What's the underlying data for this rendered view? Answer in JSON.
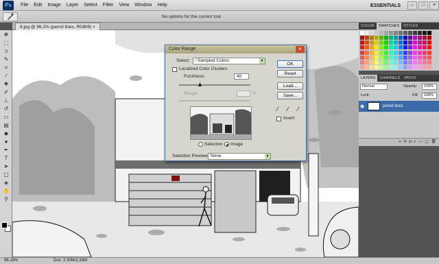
{
  "app": {
    "logo": "Ps",
    "menu": [
      "File",
      "Edit",
      "Image",
      "Layer",
      "Select",
      "Filter",
      "View",
      "Window",
      "Help"
    ],
    "workspace": "ESSENTIALS",
    "window_min": "–",
    "window_max": "□",
    "window_close": "×"
  },
  "options_bar": {
    "message": "No options for the current tool."
  },
  "document": {
    "tab_label": "8.jpg @ 96.2% (pencil lines, RGB/8)",
    "tab_close": "×"
  },
  "status_bar": {
    "zoom": "96.16%",
    "doc_size": "Doc: 2.30M/2.30M"
  },
  "panels": {
    "color_tabs": [
      "COLOR",
      "SWATCHES",
      "STYLES"
    ],
    "layer_tabs": [
      "LAYERS",
      "CHANNELS",
      "PATHS"
    ],
    "blend_mode": "Normal",
    "opacity_label": "Opacity:",
    "opacity_value": "100%",
    "lock_label": "Lock:",
    "fill_label": "Fill:",
    "fill_value": "100%",
    "layer_name": "pencil lines"
  },
  "dialog": {
    "title": "Color Range",
    "close": "×",
    "select_label": "Select:",
    "select_value": "Sampled Colors",
    "localized_label": "Localized Color Clusters",
    "fuzziness_label": "Fuzziness:",
    "fuzziness_value": "40",
    "range_label": "Range:",
    "range_unit": "%",
    "radio_selection": "Selection",
    "radio_image": "Image",
    "preview_label": "Selection Preview:",
    "preview_value": "None",
    "ok": "OK",
    "reset": "Reset",
    "load": "Load...",
    "save": "Save...",
    "invert": "Invert"
  }
}
